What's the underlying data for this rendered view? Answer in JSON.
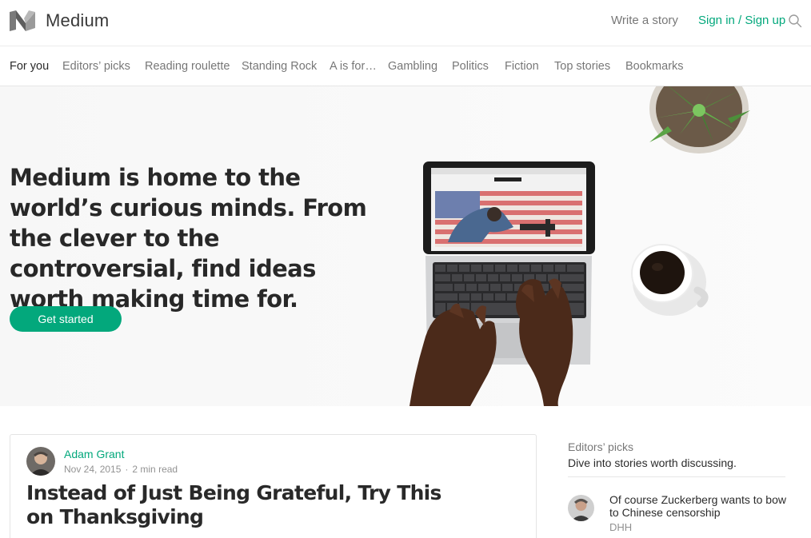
{
  "header": {
    "brand": "Medium",
    "write_label": "Write a story",
    "signin_label": "Sign in / Sign up",
    "icons": {
      "logo": "medium-logo-icon",
      "search": "search-icon"
    },
    "accent_color": "#03a87c"
  },
  "tabs": [
    {
      "label": "For you",
      "active": true
    },
    {
      "label": "Editors’ picks",
      "active": false
    },
    {
      "label": "Reading roulette",
      "active": false
    },
    {
      "label": "Standing Rock",
      "active": false
    },
    {
      "label": "A is for…",
      "active": false
    },
    {
      "label": "Gambling",
      "active": false
    },
    {
      "label": "Politics",
      "active": false
    },
    {
      "label": "Fiction",
      "active": false
    },
    {
      "label": "Top stories",
      "active": false
    },
    {
      "label": "Bookmarks",
      "active": false
    }
  ],
  "hero": {
    "headline": "Medium is home to the world’s curious minds. From the clever to the controversial, find ideas worth making time for.",
    "cta_label": "Get started"
  },
  "article": {
    "author": "Adam Grant",
    "date": "Nov 24, 2015",
    "read_time": "2 min read",
    "separator": "·",
    "title": "Instead of Just Being Grateful, Try This on Thanksgiving"
  },
  "sidebar": {
    "heading": "Editors’ picks",
    "subheading": "Dive into stories worth discussing.",
    "stories": [
      {
        "title": "Of course Zuckerberg wants to bow to Chinese censorship",
        "author": "DHH"
      }
    ]
  }
}
